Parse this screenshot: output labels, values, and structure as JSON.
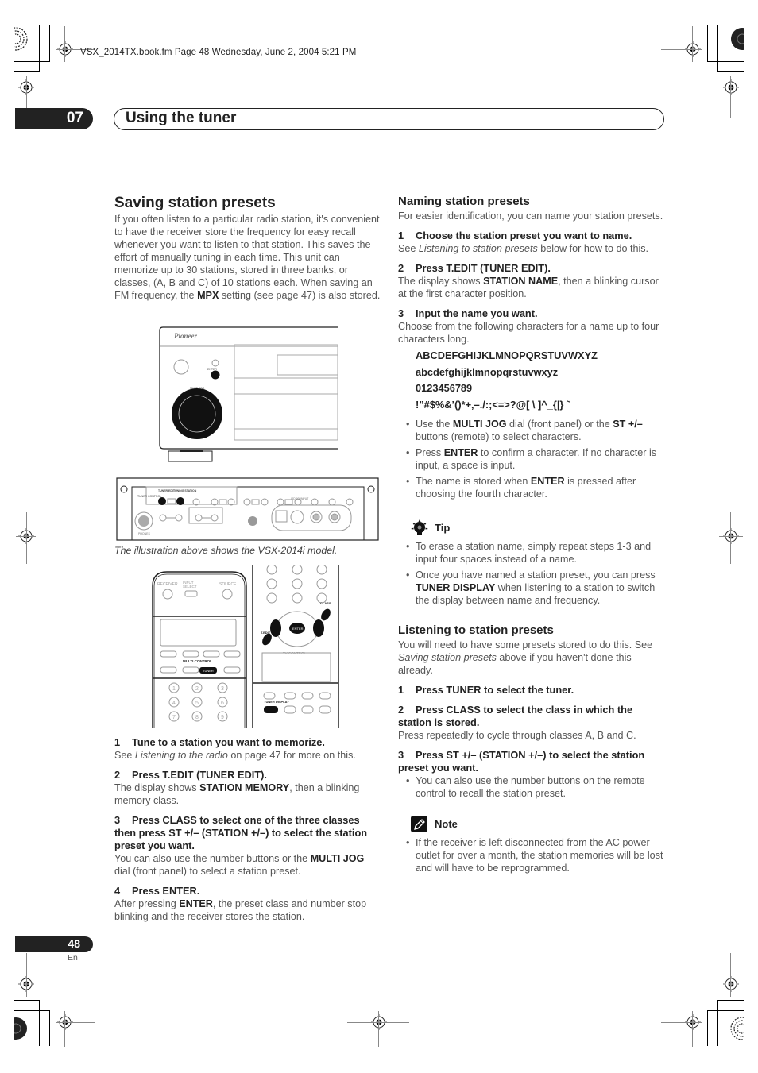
{
  "header": {
    "file_meta": "VSX_2014TX.book.fm  Page 48  Wednesday, June 2, 2004  5:21 PM",
    "chapter_number": "07",
    "chapter_title": "Using the tuner"
  },
  "saving": {
    "title": "Saving station presets",
    "intro_before_bold": "If you often listen to a particular radio station, it's convenient to have the receiver store the frequency for easy recall whenever you want to listen to that station. This saves the effort of manually tuning in each time. This unit can memorize up to 30 stations, stored in three banks, or classes, (A, B and C) of 10 stations each. When saving an FM frequency, the ",
    "intro_bold": "MPX",
    "intro_after_bold": " setting (see page 47) is also stored.",
    "front_panel": {
      "brand": "Pioneer",
      "jog_label": "MULTI JOG",
      "enter_label": "ENTER"
    },
    "panel_labels": {
      "tuner_control": "TUNER CONTROL",
      "tuner_edit": "TUNER EDIT",
      "tuning_station": "TUNING STATION",
      "band": "BAND",
      "video_input": "VIDEO INPUT",
      "phones": "PHONES"
    },
    "caption": "The illustration above shows the VSX-2014i model.",
    "remote_labels": {
      "receiver": "RECEIVER",
      "input_select": "INPUT SELECT",
      "source": "SOURCE",
      "multi_control": "MULTI CONTROL",
      "tuner": "TUNER",
      "enter": "ENTER",
      "t_edit": "T.EDIT",
      "class": "CLASS",
      "tv_control": "TV CONTROL",
      "tuner_display": "TUNER DISPLAY"
    },
    "steps": [
      {
        "num": "1",
        "title": "Tune to a station you want to memorize.",
        "body_pre": "See ",
        "body_italic": "Listening to the radio",
        "body_post": " on page 47 for more on this."
      },
      {
        "num": "2",
        "title": "Press T.EDIT (TUNER EDIT).",
        "body_pre": "The display shows ",
        "body_bold": "STATION MEMORY",
        "body_post": ", then a blinking memory class."
      },
      {
        "num": "3",
        "title": "Press CLASS to select one of the three classes then press ST +/– (STATION +/–) to select the station preset you want.",
        "body_pre": "You can also use the number buttons or the ",
        "body_bold": "MULTI JOG",
        "body_post": " dial (front panel) to select a station preset."
      },
      {
        "num": "4",
        "title": "Press ENTER.",
        "body_pre": "After pressing ",
        "body_bold": "ENTER",
        "body_post": ", the preset class and number stop blinking and the receiver stores the station."
      }
    ]
  },
  "naming": {
    "title": "Naming station presets",
    "intro": "For easier identification, you can name your station presets.",
    "step1": {
      "num": "1",
      "title": "Choose the station preset you want to name.",
      "body_pre": "See ",
      "body_italic": "Listening to station presets",
      "body_post": " below for how to do this."
    },
    "step2": {
      "num": "2",
      "title": "Press T.EDIT (TUNER EDIT).",
      "body_pre": "The display shows ",
      "body_bold": "STATION NAME",
      "body_post": ", then a blinking cursor at the first character position."
    },
    "step3": {
      "num": "3",
      "title": "Input the name you want.",
      "body": "Choose from the following characters for a name up to four characters long."
    },
    "charsets": [
      "ABCDEFGHIJKLMNOPQRSTUVWXYZ",
      "abcdefghijklmnopqrstuvwxyz",
      "0123456789",
      "!”#$%&’()*+,–./:;<=>?@[ \\ ]^_{|} ˜"
    ],
    "bullets": [
      {
        "pre": "Use the ",
        "b1": "MULTI JOG",
        "mid": " dial (front panel) or the ",
        "b2": "ST +/–",
        "post": " buttons (remote) to select characters."
      },
      {
        "pre": "Press ",
        "b1": "ENTER",
        "post": " to confirm a character. If no character is input, a space is input."
      },
      {
        "pre": "The name is stored when ",
        "b1": "ENTER",
        "post": " is pressed after choosing the fourth character."
      }
    ]
  },
  "tip": {
    "label": "Tip",
    "icon": "lightbulb-icon",
    "items": [
      {
        "pre": "To erase a station name, simply repeat steps 1-3 and input four spaces instead of a name."
      },
      {
        "pre": "Once you have named a station preset, you can press ",
        "b1": "TUNER DISPLAY",
        "post": " when listening to a station to switch the display between name and frequency."
      }
    ]
  },
  "listening": {
    "title": "Listening to station presets",
    "intro_pre": "You will need to have some presets stored to do this. See ",
    "intro_italic": "Saving station presets",
    "intro_post": " above if you haven't done this already.",
    "steps": [
      {
        "num": "1",
        "title": "Press TUNER to select the tuner."
      },
      {
        "num": "2",
        "title": "Press CLASS to select the class in which the station is stored.",
        "body": "Press repeatedly to cycle through classes A, B and C."
      },
      {
        "num": "3",
        "title": "Press ST +/– (STATION +/–) to select the station preset you want.",
        "bullet": "You can also use the number buttons on the remote control to recall the station preset."
      }
    ]
  },
  "note": {
    "label": "Note",
    "icon": "pencil-note-icon",
    "items": [
      "If the receiver is left disconnected from the AC power outlet for over a month, the station memories will be lost and will have to be reprogrammed."
    ]
  },
  "footer": {
    "page_number": "48",
    "language": "En"
  }
}
